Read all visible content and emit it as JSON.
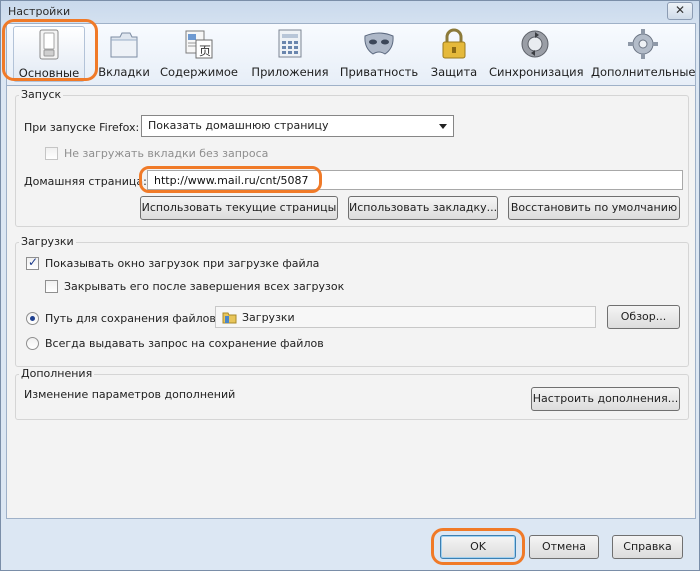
{
  "window": {
    "title": "Настройки",
    "close_glyph": "✕"
  },
  "toolbar": {
    "tabs": [
      {
        "label": "Основные",
        "icon": "switch-icon"
      },
      {
        "label": "Вкладки",
        "icon": "tabs-icon"
      },
      {
        "label": "Содержимое",
        "icon": "content-icon"
      },
      {
        "label": "Приложения",
        "icon": "applications-icon"
      },
      {
        "label": "Приватность",
        "icon": "mask-icon"
      },
      {
        "label": "Защита",
        "icon": "lock-icon"
      },
      {
        "label": "Синхронизация",
        "icon": "sync-icon"
      },
      {
        "label": "Дополнительные",
        "icon": "gear-icon"
      }
    ],
    "active_tab": "Основные"
  },
  "startup": {
    "legend": "Запуск",
    "on_start_label": "При запуске Firefox:",
    "on_start_value": "Показать домашнюю страницу",
    "no_load_tabs_label": "Не загружать вкладки без запроса",
    "no_load_tabs_checked": false,
    "homepage_label": "Домашняя страница:",
    "homepage_value": "http://www.mail.ru/cnt/5087",
    "btn_use_current": "Использовать текущие страницы",
    "btn_use_bookmark": "Использовать закладку...",
    "btn_restore_default": "Восстановить по умолчанию"
  },
  "downloads": {
    "legend": "Загрузки",
    "show_window_label": "Показывать окно загрузок при загрузке файла",
    "show_window_checked": true,
    "close_after_label": "Закрывать его после завершения всех загрузок",
    "close_after_checked": false,
    "save_path_label": "Путь для сохранения файлов",
    "save_path_value": "Загрузки",
    "browse_button": "Обзор...",
    "always_ask_label": "Всегда выдавать запрос на сохранение файлов",
    "selected_option": "save_path"
  },
  "addons": {
    "legend": "Дополнения",
    "description": "Изменение параметров дополнений",
    "configure_button": "Настроить дополнения..."
  },
  "footer": {
    "ok": "OK",
    "cancel": "Отмена",
    "help": "Справка"
  },
  "colors": {
    "highlight": "#f07a28",
    "accent_blue": "#1e3f8f"
  }
}
